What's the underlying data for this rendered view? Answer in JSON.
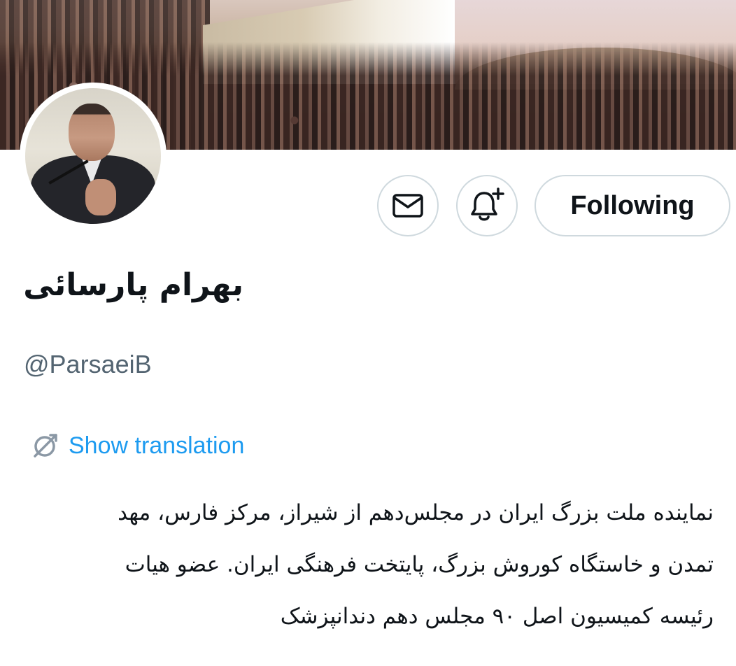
{
  "profile": {
    "display_name": "بهرام پارسائی",
    "handle": "@ParsaeiB",
    "bio_lines": [
      "نماینده ملت بزرگ ایران در مجلس‌دهم از شیراز، مرکز فارس، مهد",
      "تمدن و خاستگاه کوروش بزرگ، پایتخت فرهنگی ایران.  عضو هیات",
      "رئیسه کمیسیون اصل ۹۰ مجلس دهم دندانپزشک"
    ]
  },
  "actions": {
    "message_icon": "envelope-icon",
    "notify_icon": "bell-plus-icon",
    "follow_label": "Following"
  },
  "translation": {
    "label": "Show translation",
    "icon": "translate-icon"
  },
  "colors": {
    "link": "#1d9bf0",
    "secondary_text": "#536471",
    "border": "#cfd9de",
    "primary_text": "#0f1419"
  }
}
